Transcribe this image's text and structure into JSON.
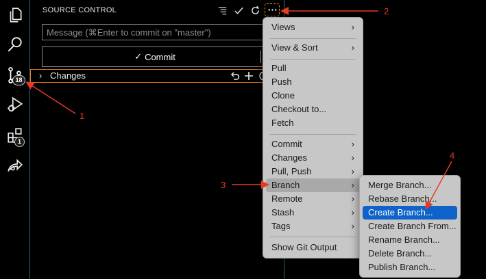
{
  "sidebar": {
    "title": "SOURCE CONTROL",
    "message_placeholder": "Message (⌘Enter to commit on \"master\")",
    "commit_label": "Commit",
    "commit_check": "✓",
    "changes_label": "Changes"
  },
  "activity_bar": {
    "items": [
      {
        "icon": "files-icon"
      },
      {
        "icon": "search-icon"
      },
      {
        "icon": "source-control-icon",
        "badge": "18"
      },
      {
        "icon": "run-debug-icon"
      },
      {
        "icon": "extensions-icon",
        "badge": "1"
      },
      {
        "icon": "remote-share-icon"
      }
    ]
  },
  "menu": {
    "items": [
      {
        "label": "Views",
        "submenu": true
      },
      {
        "label": "View & Sort",
        "submenu": true
      },
      {
        "label": "Pull"
      },
      {
        "label": "Push"
      },
      {
        "label": "Clone"
      },
      {
        "label": "Checkout to..."
      },
      {
        "label": "Fetch"
      },
      {
        "label": "Commit",
        "submenu": true
      },
      {
        "label": "Changes",
        "submenu": true
      },
      {
        "label": "Pull, Push",
        "submenu": true
      },
      {
        "label": "Branch",
        "submenu": true,
        "highlighted": true
      },
      {
        "label": "Remote",
        "submenu": true
      },
      {
        "label": "Stash",
        "submenu": true
      },
      {
        "label": "Tags",
        "submenu": true
      },
      {
        "label": "Show Git Output"
      }
    ],
    "arrow": "›"
  },
  "branch_submenu": {
    "items": [
      {
        "label": "Merge Branch..."
      },
      {
        "label": "Rebase Branch..."
      },
      {
        "label": "Create Branch...",
        "selected": true
      },
      {
        "label": "Create Branch From..."
      },
      {
        "label": "Rename Branch..."
      },
      {
        "label": "Delete Branch..."
      },
      {
        "label": "Publish Branch..."
      }
    ]
  },
  "annotations": {
    "one": "1",
    "two": "2",
    "three": "3",
    "four": "4",
    "color": "#e53b22"
  },
  "colors": {
    "highlight_orange": "#e07b1a",
    "selection_blue": "#0f62c9",
    "menu_bg": "#c7c7c7",
    "divider_teal": "#2e6d80"
  }
}
